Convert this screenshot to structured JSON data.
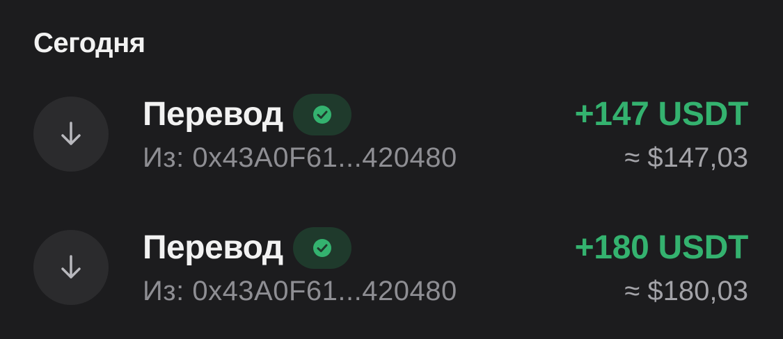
{
  "section": {
    "title": "Сегодня"
  },
  "colors": {
    "background": "#1c1c1e",
    "accent_green": "#34b26f",
    "chip_background": "#1f3a2c",
    "muted_text": "#8e8e93"
  },
  "transactions": [
    {
      "icon": "arrow-down-icon",
      "title": "Перевод",
      "status_icon": "check-circle-icon",
      "subtitle": "Из: 0x43A0F61...420480",
      "amount": "+147 USDT",
      "fiat": "≈ $147,03"
    },
    {
      "icon": "arrow-down-icon",
      "title": "Перевод",
      "status_icon": "check-circle-icon",
      "subtitle": "Из: 0x43A0F61...420480",
      "amount": "+180 USDT",
      "fiat": "≈ $180,03"
    }
  ]
}
